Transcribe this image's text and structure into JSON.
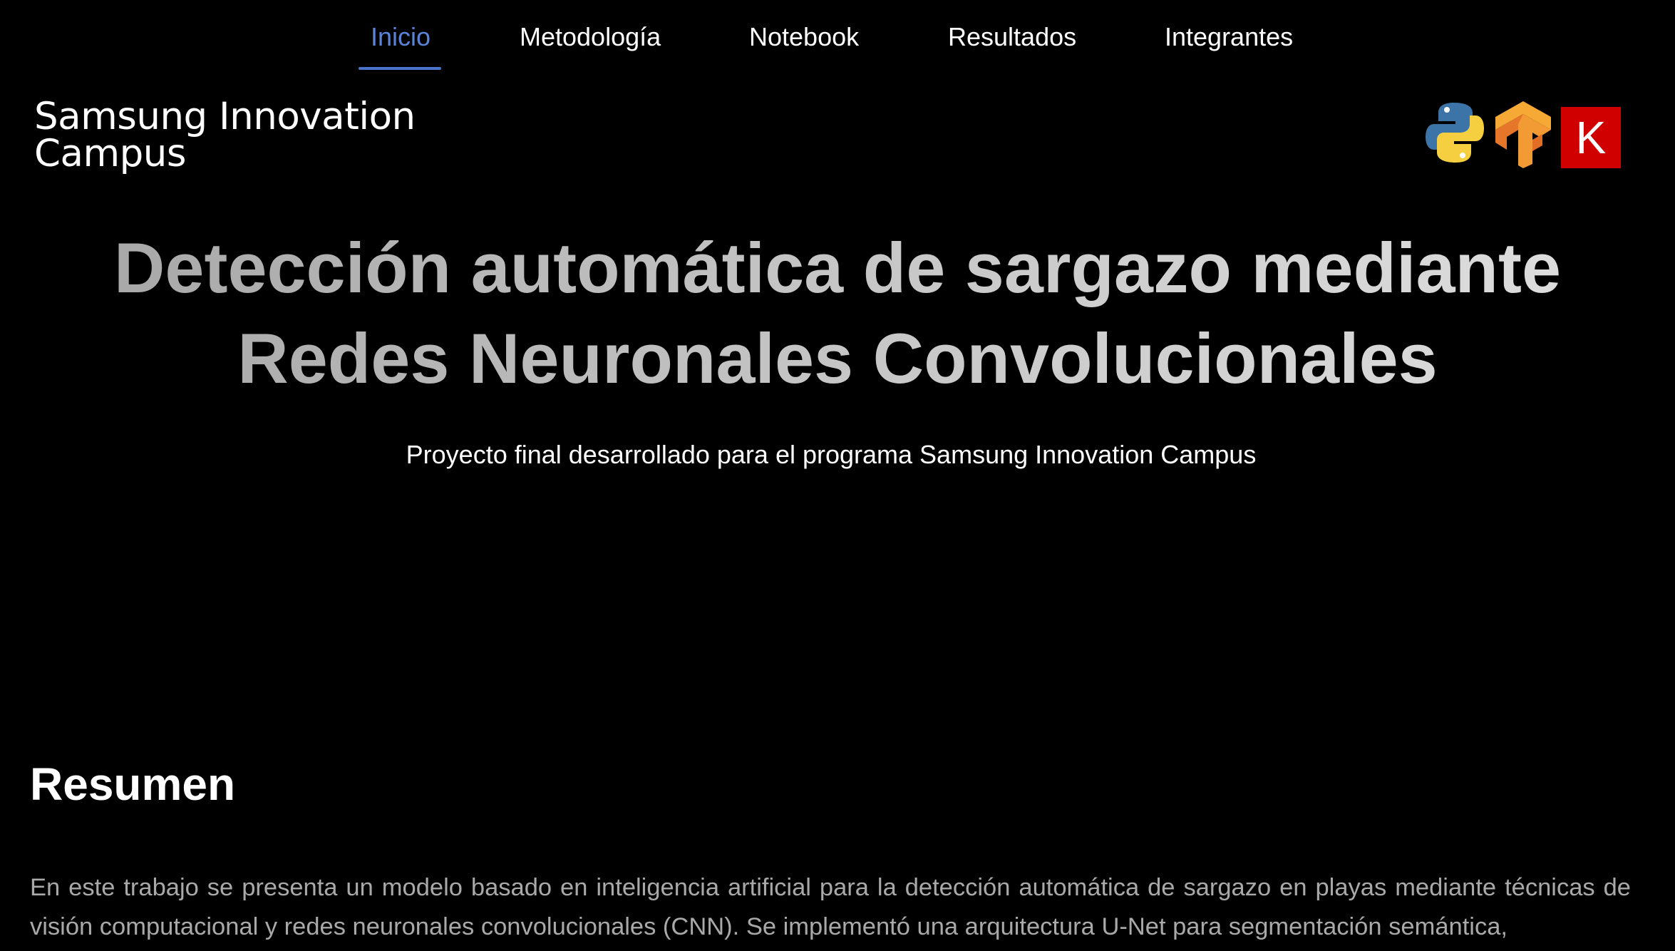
{
  "nav": {
    "items": [
      {
        "label": "Inicio",
        "active": true
      },
      {
        "label": "Metodología",
        "active": false
      },
      {
        "label": "Notebook",
        "active": false
      },
      {
        "label": "Resultados",
        "active": false
      },
      {
        "label": "Integrantes",
        "active": false
      }
    ],
    "active_color": "#5b84d8"
  },
  "header": {
    "brand_line1": "Samsung Innovation",
    "brand_line2": "Campus",
    "tech_logos": [
      {
        "icon": "python-icon"
      },
      {
        "icon": "tensorflow-icon"
      },
      {
        "icon": "keras-icon",
        "letter": "K",
        "color": "#d00000"
      }
    ]
  },
  "hero": {
    "title_line1": "Detección automática de sargazo mediante",
    "title_line2": "Redes Neuronales Convolucionales",
    "subtitle": "Proyecto final desarrollado para el programa Samsung Innovation Campus"
  },
  "summary": {
    "heading": "Resumen",
    "text": "En este trabajo se presenta un modelo basado en inteligencia artificial para la detección automática de sargazo en playas mediante técnicas de visión computacional y redes neuronales convolucionales (CNN). Se implementó una arquitectura U-Net para segmentación semántica,"
  },
  "colors": {
    "background": "#000000",
    "text": "#ffffff",
    "muted_text": "#a9a9a9",
    "accent": "#4a74c9"
  }
}
